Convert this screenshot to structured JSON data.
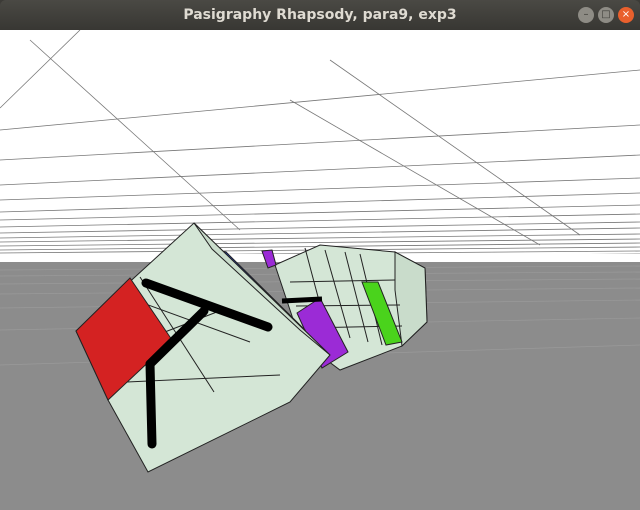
{
  "window": {
    "title": "Pasigraphy Rhapsody, para9, exp3",
    "buttons": {
      "minimize_icon": "minimize-icon",
      "maximize_icon": "maximize-icon",
      "close_icon": "close-icon"
    }
  },
  "scene": {
    "sky_color": "#ffffff",
    "floor_color": "#8c8c8c",
    "face_color": "#d4e6d6",
    "accent_colors": {
      "red": "#d42222",
      "purple": "#9b2bd6",
      "green": "#4ad31c",
      "blue": "#2244cc",
      "black": "#000000"
    }
  }
}
